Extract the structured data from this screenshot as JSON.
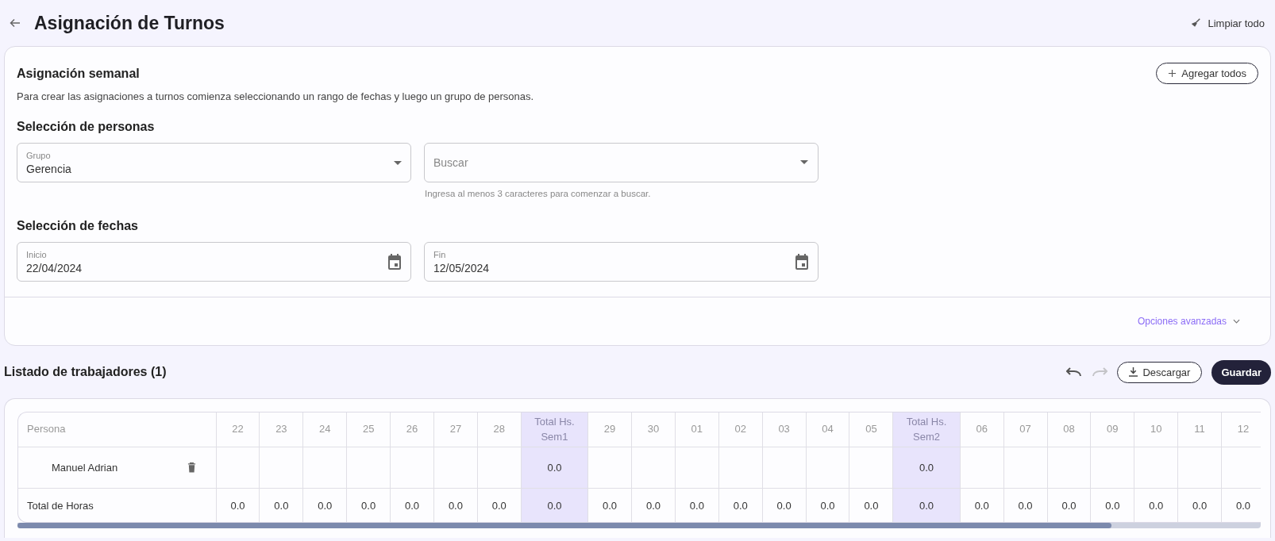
{
  "header": {
    "title": "Asignación de Turnos",
    "clear_all": "Limpiar todo"
  },
  "weekly": {
    "title": "Asignación semanal",
    "add_all": "Agregar todos",
    "description": "Para crear las asignaciones a turnos comienza seleccionando un rango de fechas y luego un grupo de personas.",
    "people_title": "Selección de personas",
    "group_field": {
      "label": "Grupo",
      "value": "Gerencia"
    },
    "search_field": {
      "placeholder": "Buscar",
      "hint": "Ingresa al menos 3 caracteres para comenzar a buscar."
    },
    "dates_title": "Selección de fechas",
    "start_field": {
      "label": "Inicio",
      "value": "22/04/2024"
    },
    "end_field": {
      "label": "Fin",
      "value": "12/05/2024"
    },
    "advanced": {
      "label": "Opciones avanzadas",
      "expanded": false
    }
  },
  "workers": {
    "title": "Listado de trabajadores (1)",
    "undo": {
      "disabled": false
    },
    "redo": {
      "disabled": true
    },
    "download": "Descargar",
    "save": "Guardar"
  },
  "table": {
    "columns": [
      {
        "kind": "person",
        "label": "Persona"
      },
      {
        "kind": "day",
        "label": "22"
      },
      {
        "kind": "day",
        "label": "23"
      },
      {
        "kind": "day",
        "label": "24"
      },
      {
        "kind": "day",
        "label": "25"
      },
      {
        "kind": "day",
        "label": "26"
      },
      {
        "kind": "day",
        "label": "27"
      },
      {
        "kind": "day",
        "label": "28"
      },
      {
        "kind": "total",
        "label": "Total Hs.",
        "label_2": "Sem1"
      },
      {
        "kind": "day",
        "label": "29"
      },
      {
        "kind": "day",
        "label": "30"
      },
      {
        "kind": "day",
        "label": "01"
      },
      {
        "kind": "day",
        "label": "02"
      },
      {
        "kind": "day",
        "label": "03"
      },
      {
        "kind": "day",
        "label": "04"
      },
      {
        "kind": "day",
        "label": "05"
      },
      {
        "kind": "total",
        "label": "Total Hs.",
        "label_2": "Sem2"
      },
      {
        "kind": "day",
        "label": "06"
      },
      {
        "kind": "day",
        "label": "07"
      },
      {
        "kind": "day",
        "label": "08"
      },
      {
        "kind": "day",
        "label": "09"
      },
      {
        "kind": "day",
        "label": "10"
      },
      {
        "kind": "day",
        "label": "11"
      },
      {
        "kind": "day",
        "label": "12"
      }
    ],
    "rows": [
      {
        "kind": "worker",
        "cells": [
          "Manuel Adrian",
          "",
          "",
          "",
          "",
          "",
          "",
          "",
          "0.0",
          "",
          "",
          "",
          "",
          "",
          "",
          "",
          "0.0",
          "",
          "",
          "",
          "",
          "",
          "",
          ""
        ]
      },
      {
        "kind": "total",
        "cells": [
          "Total de Horas",
          "0.0",
          "0.0",
          "0.0",
          "0.0",
          "0.0",
          "0.0",
          "0.0",
          "0.0",
          "0.0",
          "0.0",
          "0.0",
          "0.0",
          "0.0",
          "0.0",
          "0.0",
          "0.0",
          "0.0",
          "0.0",
          "0.0",
          "0.0",
          "0.0",
          "0.0",
          "0.0"
        ]
      }
    ]
  }
}
